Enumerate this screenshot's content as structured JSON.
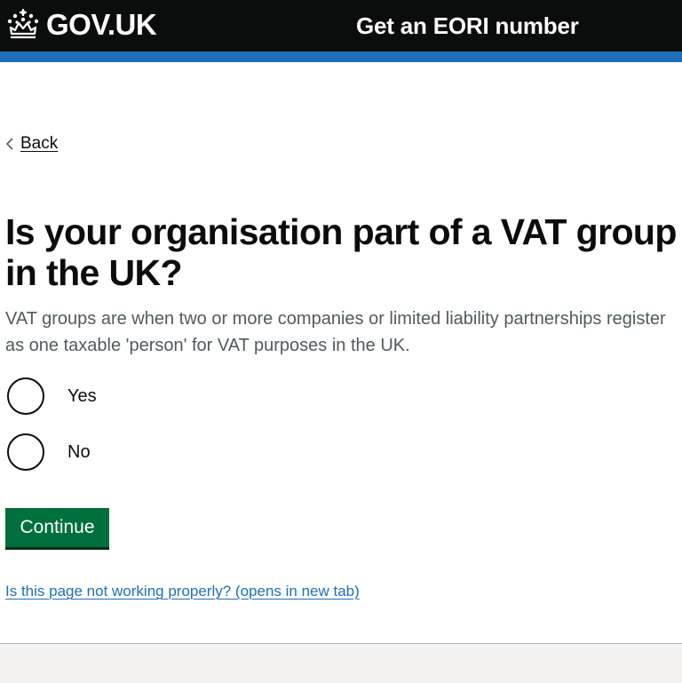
{
  "header": {
    "logo_text": "GOV.UK",
    "logo_icon": "crown-icon",
    "service_name": "Get an EORI number",
    "colors": {
      "background": "#0b0c0c",
      "accent_bar": "#1d70b8",
      "text": "#ffffff"
    }
  },
  "navigation": {
    "back_label": "Back",
    "back_icon": "chevron-left-icon"
  },
  "question": {
    "heading": "Is your organisation part of a VAT group in the UK?",
    "hint": "VAT groups are when two or more companies or limited liability partnerships register as one taxable 'person' for VAT purposes in the UK.",
    "options": [
      {
        "label": "Yes",
        "selected": false
      },
      {
        "label": "No",
        "selected": false
      }
    ]
  },
  "actions": {
    "continue_label": "Continue",
    "continue_color": "#00703c"
  },
  "feedback": {
    "report_link": "Is this page not working properly? (opens in new tab)",
    "link_color": "#1d70b8"
  }
}
